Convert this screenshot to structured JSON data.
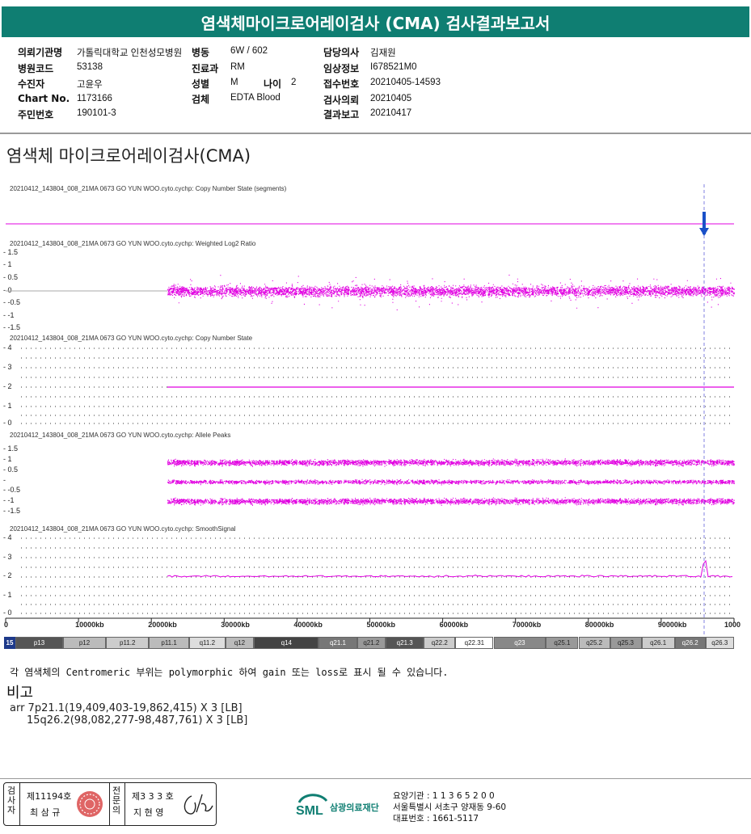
{
  "header": {
    "title": "염색체마이크로어레이검사 (CMA) 검사결과보고서"
  },
  "info": {
    "hospital_label": "의뢰기관명",
    "hospital": "가톨릭대학교 인천성모병원",
    "ward_label": "병동",
    "ward": "6W / 602",
    "doctor_label": "담당의사",
    "doctor": "김재원",
    "code_label": "병원코드",
    "code": "53138",
    "dept_label": "진료과",
    "dept": "RM",
    "clinical_label": "임상정보",
    "clinical": "I678521M0",
    "name_label": "수진자",
    "name": "고윤우",
    "sex_label": "성별",
    "sex": "M",
    "age_label": "나이",
    "age": "2",
    "receipt_label": "접수번호",
    "receipt": "20210405-14593",
    "chart_label": "Chart No.",
    "chart": "1173166",
    "specimen_label": "검체",
    "specimen": "EDTA Blood",
    "request_label": "검사의뢰",
    "request": "20210405",
    "id_label": "주민번호",
    "id": "190101-3",
    "report_label": "결과보고",
    "report": "20210417"
  },
  "section_title": "염색체 마이크로어레이검사(CMA)",
  "tracks": {
    "t1": "20210412_143804_008_21MA 0673 GO YUN WOO.cyto.cychp: Copy Number State (segments)",
    "t2": "20210412_143804_008_21MA 0673 GO YUN WOO.cyto.cychp: Weighted Log2 Ratio",
    "t3": "20210412_143804_008_21MA 0673 GO YUN WOO.cyto.cychp: Copy Number State",
    "t4": "20210412_143804_008_21MA 0673 GO YUN WOO.cyto.cychp: Allele Peaks",
    "t5": "20210412_143804_008_21MA 0673 GO YUN WOO.cyto.cychp: SmoothSignal"
  },
  "ticks": {
    "log2": [
      "1.5",
      "1",
      "0.5",
      "0",
      "-0.5",
      "-1",
      "-1.5"
    ],
    "cn": [
      "4",
      "3",
      "2",
      "1",
      "0"
    ],
    "allele": [
      "1.5",
      "1",
      "0.5",
      "",
      "-0.5",
      "-1",
      "-1.5"
    ],
    "smooth": [
      "4",
      "3",
      "2",
      "1",
      "0"
    ]
  },
  "axis": {
    "labels": [
      "0",
      "10000kb",
      "20000kb",
      "30000kb",
      "40000kb",
      "50000kb",
      "60000kb",
      "70000kb",
      "80000kb",
      "90000kb",
      "1000"
    ]
  },
  "ideogram": {
    "chrom": "15",
    "bands": [
      "p13",
      "p12",
      "p11.2",
      "p11.1",
      "q11.2",
      "q12",
      "q14",
      "q21.1",
      "q21.2",
      "q21.3",
      "q22.2",
      "q22.31",
      "q23",
      "q25.1",
      "q25.2",
      "q25.3",
      "q26.1",
      "q26.2",
      "q26.3"
    ]
  },
  "note": "각 염색체의 Centromeric 부위는 polymorphic 하여 gain 또는 loss로 표시 될 수 있습니다.",
  "remarks": {
    "title": "비고",
    "line1": "arr 7p21.1(19,409,403-19,862,415) X 3 [LB]",
    "line2": "15q26.2(98,082,277-98,487,761) X 3 [LB]"
  },
  "footer": {
    "role1": "검사자",
    "id1": "제11194호",
    "name1": "최 삼 규",
    "role2": "전문의",
    "id2": "제3 3 3 호",
    "name2": "지 현 영",
    "org_logo": "SML",
    "org_name": "삼광의료재단",
    "line1": "요양기관 : 1 1 3 6 5 2 0 0",
    "line2": "서울특별시 서초구 양재동 9-60",
    "line3": "대표번호 : 1661-5117"
  },
  "colors": {
    "accent": "#0f7e72",
    "data": "#e100e1",
    "cursor": "#1a50c8"
  }
}
